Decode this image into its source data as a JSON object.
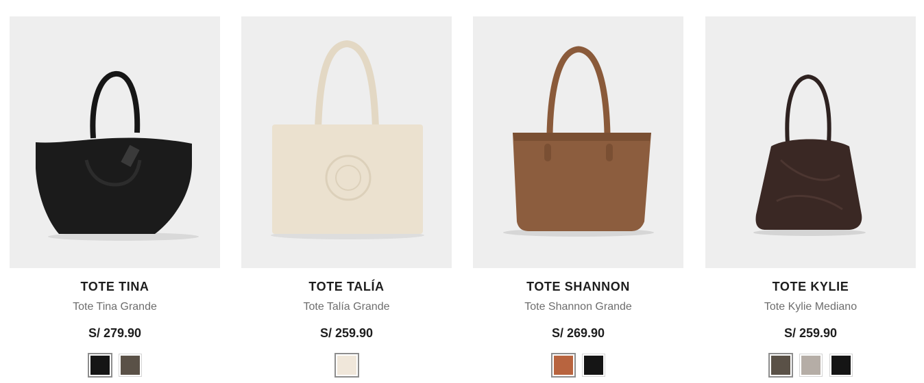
{
  "products": [
    {
      "title": "TOTE TINA",
      "subtitle": "Tote Tina Grande",
      "price": "S/ 279.90",
      "image_icon": "black-tote-bag",
      "swatches": [
        {
          "name": "black",
          "color": "#151515",
          "selected": true
        },
        {
          "name": "taupe",
          "color": "#5a5147",
          "selected": false
        }
      ]
    },
    {
      "title": "TOTE TALÍA",
      "subtitle": "Tote Talía Grande",
      "price": "S/ 259.90",
      "image_icon": "cream-tote-bag",
      "swatches": [
        {
          "name": "cream",
          "color": "#f0e7da",
          "selected": true
        }
      ]
    },
    {
      "title": "TOTE SHANNON",
      "subtitle": "Tote Shannon Grande",
      "price": "S/ 269.90",
      "image_icon": "brown-tote-bag",
      "swatches": [
        {
          "name": "cognac",
          "color": "#b8643f",
          "selected": true
        },
        {
          "name": "black",
          "color": "#151515",
          "selected": false
        }
      ]
    },
    {
      "title": "TOTE KYLIE",
      "subtitle": "Tote Kylie Mediano",
      "price": "S/ 259.90",
      "image_icon": "dark-brown-tote-bag",
      "swatches": [
        {
          "name": "dark-taupe",
          "color": "#5a5147",
          "selected": true
        },
        {
          "name": "greige",
          "color": "#b5ada6",
          "selected": false
        },
        {
          "name": "black",
          "color": "#151515",
          "selected": false
        }
      ]
    }
  ]
}
